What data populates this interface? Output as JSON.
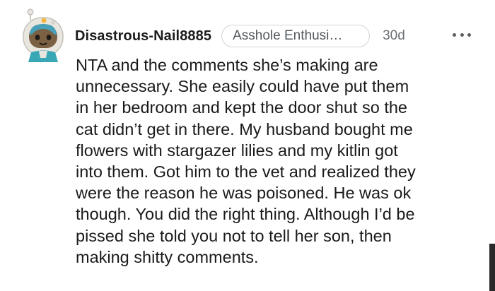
{
  "comment": {
    "author": "Disastrous-Nail8885",
    "flair": "Asshole Enthusi…",
    "age": "30d",
    "more_icon": "more-horizontal-icon",
    "body_lines": [
      "NTA and the comments she’s making are",
      "unnecessary. She easily could have put them",
      "in her bedroom and kept the door shut so the",
      "cat didn’t get in there. My husband bought me",
      "flowers with stargazer lilies and my kitlin got",
      "into them. Got him to the vet and realized they",
      "were the reason he was poisoned. He was ok",
      "though. You did the right thing. Although I’d be",
      "pissed she told you not to tell her son, then",
      "making shitty comments."
    ]
  },
  "colors": {
    "text": "#1a1a1b",
    "meta": "#6a6e72",
    "flair_border": "#cfd3d6",
    "avatar_bg": "#7b6043",
    "avatar_frame": "#e8e6df"
  }
}
